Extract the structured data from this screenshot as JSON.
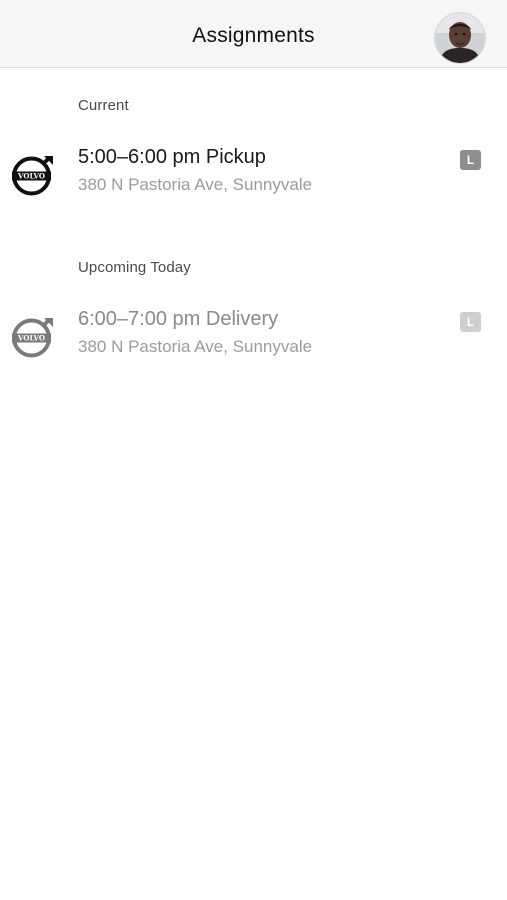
{
  "header": {
    "title": "Assignments",
    "avatar_icon": "user-avatar-photo"
  },
  "sections": [
    {
      "label": "Current",
      "items": [
        {
          "brand": "VOLVO",
          "brand_icon": "volvo-logo-icon",
          "title": "5:00–6:00 pm Pickup",
          "address": "380 N Pastoria Ave, Sunnyvale",
          "badge": "L"
        }
      ]
    },
    {
      "label": "Upcoming Today",
      "items": [
        {
          "brand": "VOLVO",
          "brand_icon": "volvo-logo-icon",
          "title": "6:00–7:00 pm Delivery",
          "address": "380 N Pastoria Ave, Sunnyvale",
          "badge": "L"
        }
      ]
    }
  ],
  "colors": {
    "navbar_bg": "#f6f6f6",
    "current_logo": "#111111",
    "upcoming_logo": "#7a7a7a",
    "current_badge": "#8e8e8e",
    "upcoming_badge": "#cfcfcf",
    "secondary_text": "#9b9b9b"
  }
}
